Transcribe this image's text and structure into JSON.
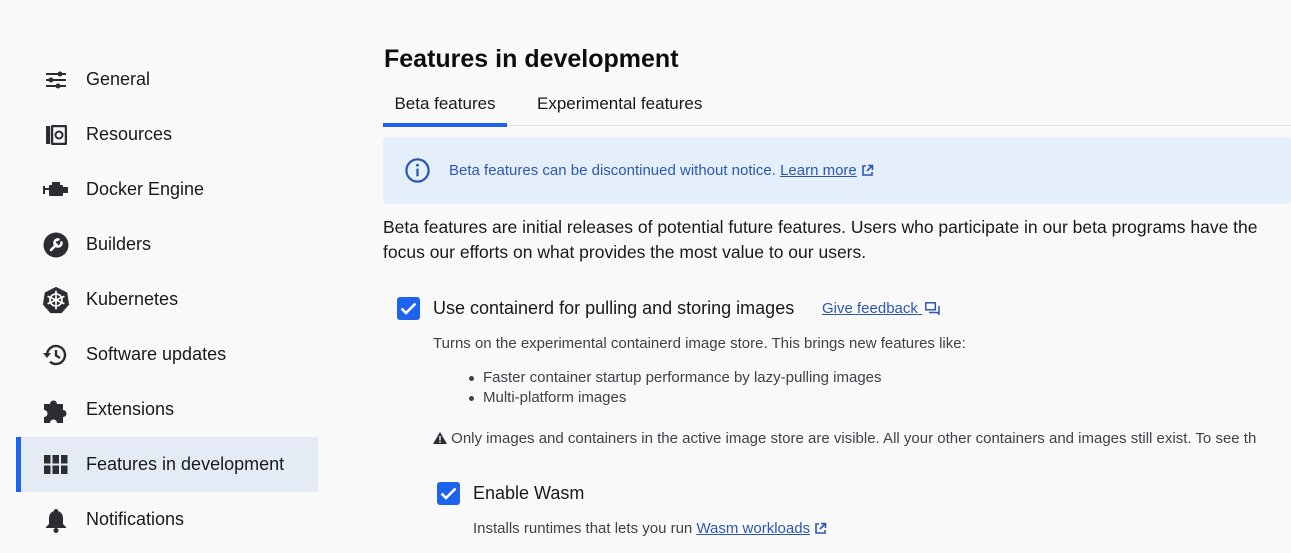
{
  "sidebar": {
    "items": [
      {
        "label": "General",
        "icon": "sliders-icon"
      },
      {
        "label": "Resources",
        "icon": "resources-icon"
      },
      {
        "label": "Docker Engine",
        "icon": "engine-icon"
      },
      {
        "label": "Builders",
        "icon": "wrench-icon"
      },
      {
        "label": "Kubernetes",
        "icon": "kubernetes-icon"
      },
      {
        "label": "Software updates",
        "icon": "history-icon"
      },
      {
        "label": "Extensions",
        "icon": "puzzle-icon"
      },
      {
        "label": "Features in development",
        "icon": "grid-icon",
        "active": true
      },
      {
        "label": "Notifications",
        "icon": "bell-icon"
      }
    ]
  },
  "main": {
    "title": "Features in development",
    "tabs": [
      {
        "label": "Beta features",
        "active": true
      },
      {
        "label": "Experimental features"
      }
    ],
    "alert": {
      "message": "Beta features can be discontinued without notice.",
      "link": "Learn more"
    },
    "description": {
      "line1": "Beta features are initial releases of potential future features. Users who participate in our beta programs have the",
      "line2": "focus our efforts on what provides the most value to our users."
    },
    "containerd": {
      "checked": true,
      "label": "Use containerd for pulling and storing images",
      "feedback": "Give feedback",
      "intro": "Turns on the experimental containerd image store. This brings new features like:",
      "bullets": [
        "Faster container startup performance by lazy-pulling images",
        "Multi-platform images"
      ],
      "warning": "Only images and containers in the active image store are visible. All your other containers and images still exist. To see th"
    },
    "wasm": {
      "checked": true,
      "label": "Enable Wasm",
      "help_prefix": "Installs runtimes that lets you run",
      "help_link": "Wasm workloads"
    }
  },
  "colors": {
    "accent": "#1d63ed",
    "active_bg": "#e5ebf5",
    "alert_bg": "#e5effb",
    "link": "#2b57b3"
  }
}
